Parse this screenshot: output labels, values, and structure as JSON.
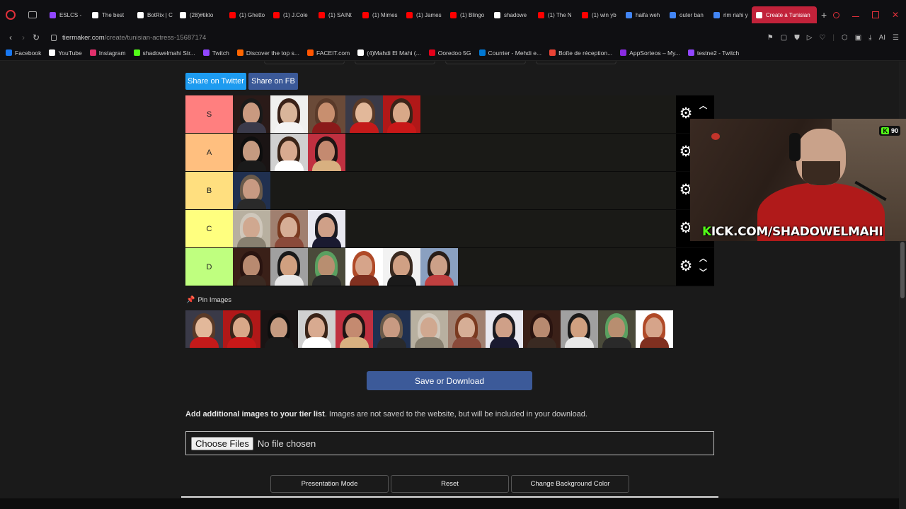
{
  "browser": {
    "tabs": [
      {
        "label": "ESLCS - ",
        "color": "#9146ff"
      },
      {
        "label": "The best",
        "color": "#ffffff"
      },
      {
        "label": "BotRix | C",
        "color": "#ffffff"
      },
      {
        "label": "(28)#tikto",
        "color": "#ffffff"
      },
      {
        "label": "(1) Ghetto",
        "color": "#ff0000"
      },
      {
        "label": "(1) J.Cole",
        "color": "#ff0000"
      },
      {
        "label": "(1) SAINt",
        "color": "#ff0000"
      },
      {
        "label": "(1) Mimes",
        "color": "#ff0000"
      },
      {
        "label": "(1) James",
        "color": "#ff0000"
      },
      {
        "label": "(1) Blingo",
        "color": "#ff0000"
      },
      {
        "label": "shadowe",
        "color": "#ffffff"
      },
      {
        "label": "(1) The N",
        "color": "#ff0000"
      },
      {
        "label": "(1) win yb",
        "color": "#ff0000"
      },
      {
        "label": "haifa weh",
        "color": "#4285f4"
      },
      {
        "label": "outer ban",
        "color": "#4285f4"
      },
      {
        "label": "rim riahi y",
        "color": "#4285f4"
      },
      {
        "label": "Create a Tunisian",
        "color": "#ffffff"
      }
    ],
    "url_host": "tiermaker.com",
    "url_path": "/create/tunisian-actress-15687174",
    "addr_ai": "AI",
    "bookmarks": [
      {
        "label": "Facebook",
        "color": "#1877f2"
      },
      {
        "label": "YouTube",
        "color": "#ffffff"
      },
      {
        "label": "Instagram",
        "color": "#e1306c"
      },
      {
        "label": "shadowelmahi Str...",
        "color": "#53fc18"
      },
      {
        "label": "Twitch",
        "color": "#9146ff"
      },
      {
        "label": "Discover the top s...",
        "color": "#ff6600"
      },
      {
        "label": "FACEIT.com",
        "color": "#ff5500"
      },
      {
        "label": "(4)Mahdi El Mahi (...",
        "color": "#ffffff"
      },
      {
        "label": "Ooredoo 5G",
        "color": "#e2001a"
      },
      {
        "label": "Courrier - Mehdi e...",
        "color": "#0078d4"
      },
      {
        "label": "Boîte de réception...",
        "color": "#ea4335"
      },
      {
        "label": "AppSorteos – My...",
        "color": "#8a2be2"
      },
      {
        "label": "testne2 - Twitch",
        "color": "#9146ff"
      }
    ]
  },
  "page": {
    "share_twitter": "Share on Twitter",
    "share_fb": "Share on FB",
    "tiers": [
      {
        "label": "S",
        "color": "#ff7f7f",
        "items": 5
      },
      {
        "label": "A",
        "color": "#ffbf7f",
        "items": 3
      },
      {
        "label": "B",
        "color": "#ffdf7f",
        "items": 1
      },
      {
        "label": "C",
        "color": "#ffff7f",
        "items": 3
      },
      {
        "label": "D",
        "color": "#bfff7f",
        "items": 6
      }
    ],
    "pin_label": "Pin Images",
    "pool_items": 13,
    "save_label": "Save or Download",
    "add_bold": "Add additional images to your tier list",
    "add_rest": ". Images are not saved to the website, but will be included in your download.",
    "file_button": "Choose Files",
    "file_status": "No file chosen",
    "btn_presentation": "Presentation Mode",
    "btn_reset": "Reset",
    "btn_bg": "Change Background Color"
  },
  "webcam": {
    "badge_count": "90",
    "badge_k": "K",
    "channel_k": "K",
    "channel_rest": "ICK.COM/SHADOWELMAHI"
  }
}
